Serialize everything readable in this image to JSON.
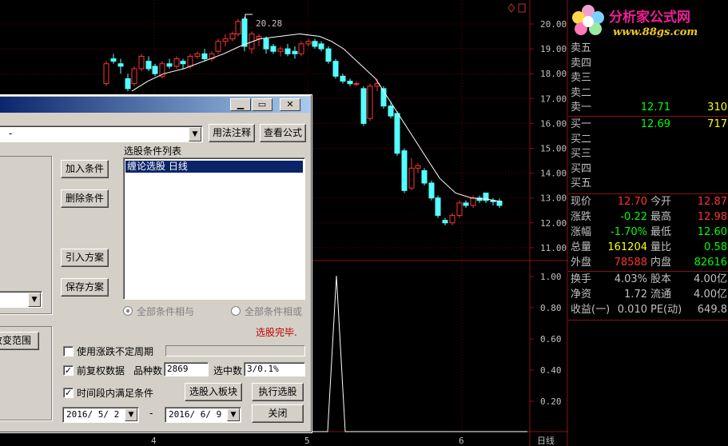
{
  "chart": {
    "type": "candlestick",
    "period_label": "日线",
    "high_marker": "20.28",
    "price_axis": [
      "20.00",
      "19.00",
      "18.00",
      "17.00",
      "16.00",
      "15.00",
      "14.00",
      "13.00",
      "12.00",
      "11.00"
    ],
    "indicator_axis": [
      "1.00",
      "0.80",
      "0.60",
      "0.40",
      "0.20"
    ],
    "month_ticks": [
      "4",
      "5",
      "6"
    ],
    "colors": {
      "up": "#ff3232",
      "down": "#54ffff",
      "ma": "#ffffff",
      "grid": "#8a1010",
      "axis_text": "#c0c0c0"
    }
  },
  "logo": {
    "title": "分析家公式网",
    "url": "www.88gs.com"
  },
  "quote": {
    "asks": [
      {
        "label": "卖五",
        "price": "",
        "vol": ""
      },
      {
        "label": "卖四",
        "price": "",
        "vol": ""
      },
      {
        "label": "卖三",
        "price": "",
        "vol": ""
      },
      {
        "label": "卖二",
        "price": "",
        "vol": ""
      },
      {
        "label": "卖一",
        "price": "12.71",
        "vol": "310"
      }
    ],
    "bids": [
      {
        "label": "买一",
        "price": "12.69",
        "vol": "717"
      },
      {
        "label": "买二",
        "price": "",
        "vol": ""
      },
      {
        "label": "买三",
        "price": "",
        "vol": ""
      },
      {
        "label": "买四",
        "price": "",
        "vol": ""
      },
      {
        "label": "买五",
        "price": "",
        "vol": ""
      }
    ],
    "stats": [
      {
        "l1": "现价",
        "v1": "12.70",
        "c1": "#ff3232",
        "l2": "今开",
        "v2": "12.87",
        "c2": "#ff3232"
      },
      {
        "l1": "涨跌",
        "v1": "-0.22",
        "c1": "#00ff00",
        "l2": "最高",
        "v2": "12.98",
        "c2": "#ff3232"
      },
      {
        "l1": "涨幅",
        "v1": "-1.70%",
        "c1": "#00ff00",
        "l2": "最低",
        "v2": "12.60",
        "c2": "#00ff00"
      },
      {
        "l1": "总量",
        "v1": "161204",
        "c1": "#ffff00",
        "l2": "量比",
        "v2": "0.58",
        "c2": "#00ff00"
      },
      {
        "l1": "外盘",
        "v1": "78588",
        "c1": "#ff3232",
        "l2": "内盘",
        "v2": "82616",
        "c2": "#00ff00"
      }
    ],
    "fund": [
      {
        "l1": "换手",
        "v1": "4.03%",
        "l2": "股本",
        "v2": "4.00亿"
      },
      {
        "l1": "净资",
        "v1": "1.72",
        "l2": "流通",
        "v2": "4.00亿"
      },
      {
        "l1": "收益(一)",
        "v1": "0.010",
        "l2": "PE(动)",
        "v2": "649.8"
      }
    ]
  },
  "dialog": {
    "formula_combo": "-",
    "btn_usage": "用法注释",
    "btn_view_formula": "查看公式",
    "list_title": "选股条件列表",
    "list_items": [
      "缠论选股  日线"
    ],
    "btn_add": "加入条件",
    "btn_delete": "删除条件",
    "btn_import": "引入方案",
    "btn_save": "保存方案",
    "radio_and": "全部条件相与",
    "radio_or": "全部条件相或",
    "status": "选股完毕.",
    "btn_change_range": "改变范围",
    "chk_irregular": "使用涨跌不定周期",
    "chk_prev_restore": "前复权数据",
    "count_label": "品种数",
    "count_value": "2869",
    "selected_label": "选中数",
    "selected_value": "3/0.1%",
    "chk_period": "时间段内满足条件",
    "btn_to_block": "选股入板块",
    "btn_execute": "执行选股",
    "date_from": "2016/ 5/ 2",
    "date_sep": "-",
    "date_to": "2016/ 6/ 9",
    "btn_close": "关闭"
  }
}
